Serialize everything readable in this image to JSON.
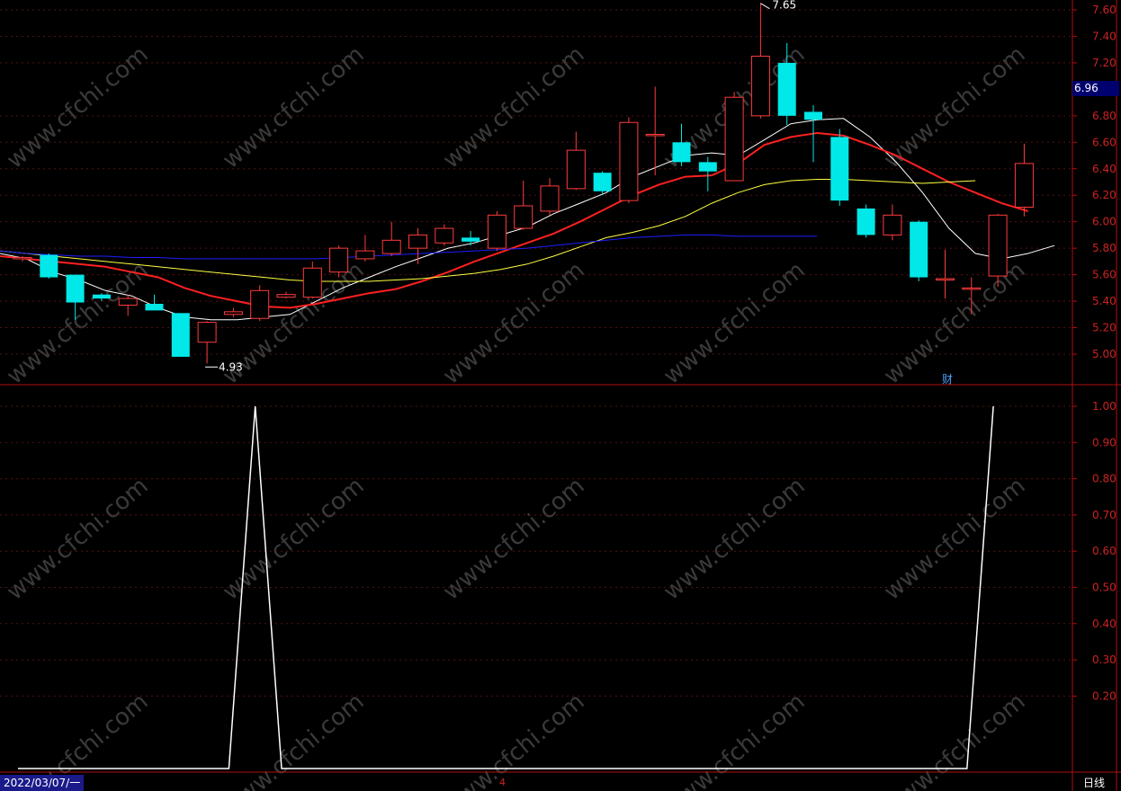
{
  "chart_data": [
    {
      "type": "candlestick",
      "ylim": [
        4.8,
        7.7
      ],
      "y_ticks": [
        "7.60",
        "7.40",
        "7.20",
        "6.80",
        "6.60",
        "6.40",
        "6.20",
        "6.00",
        "5.80",
        "5.60",
        "5.40",
        "5.20",
        "5.00"
      ],
      "candles": [
        {
          "o": 5.72,
          "h": 5.74,
          "l": 5.7,
          "c": 5.73
        },
        {
          "o": 5.75,
          "h": 5.76,
          "l": 5.57,
          "c": 5.58
        },
        {
          "o": 5.6,
          "h": 5.6,
          "l": 5.26,
          "c": 5.39
        },
        {
          "o": 5.45,
          "h": 5.46,
          "l": 5.4,
          "c": 5.42
        },
        {
          "o": 5.37,
          "h": 5.45,
          "l": 5.29,
          "c": 5.42
        },
        {
          "o": 5.38,
          "h": 5.45,
          "l": 5.33,
          "c": 5.33
        },
        {
          "o": 5.31,
          "h": 5.31,
          "l": 4.98,
          "c": 4.98
        },
        {
          "o": 5.09,
          "h": 5.25,
          "l": 4.93,
          "c": 5.24
        },
        {
          "o": 5.3,
          "h": 5.35,
          "l": 5.28,
          "c": 5.32
        },
        {
          "o": 5.27,
          "h": 5.52,
          "l": 5.25,
          "c": 5.48
        },
        {
          "o": 5.43,
          "h": 5.47,
          "l": 5.42,
          "c": 5.45
        },
        {
          "o": 5.43,
          "h": 5.7,
          "l": 5.42,
          "c": 5.65
        },
        {
          "o": 5.62,
          "h": 5.82,
          "l": 5.58,
          "c": 5.8
        },
        {
          "o": 5.72,
          "h": 5.9,
          "l": 5.7,
          "c": 5.78
        },
        {
          "o": 5.76,
          "h": 6.0,
          "l": 5.74,
          "c": 5.86
        },
        {
          "o": 5.8,
          "h": 5.95,
          "l": 5.68,
          "c": 5.9
        },
        {
          "o": 5.84,
          "h": 5.98,
          "l": 5.82,
          "c": 5.95
        },
        {
          "o": 5.88,
          "h": 5.93,
          "l": 5.82,
          "c": 5.85
        },
        {
          "o": 5.8,
          "h": 6.08,
          "l": 5.78,
          "c": 6.05
        },
        {
          "o": 5.95,
          "h": 6.31,
          "l": 5.94,
          "c": 6.12
        },
        {
          "o": 6.08,
          "h": 6.33,
          "l": 6.05,
          "c": 6.27
        },
        {
          "o": 6.25,
          "h": 6.68,
          "l": 6.24,
          "c": 6.54
        },
        {
          "o": 6.37,
          "h": 6.38,
          "l": 6.2,
          "c": 6.23
        },
        {
          "o": 6.16,
          "h": 6.79,
          "l": 6.14,
          "c": 6.75
        },
        {
          "o": 6.65,
          "h": 7.02,
          "l": 6.35,
          "c": 6.66
        },
        {
          "o": 6.6,
          "h": 6.74,
          "l": 6.42,
          "c": 6.45
        },
        {
          "o": 6.45,
          "h": 6.49,
          "l": 6.23,
          "c": 6.38
        },
        {
          "o": 6.31,
          "h": 6.98,
          "l": 6.31,
          "c": 6.94
        },
        {
          "o": 6.8,
          "h": 7.65,
          "l": 6.78,
          "c": 7.25
        },
        {
          "o": 7.2,
          "h": 7.35,
          "l": 6.73,
          "c": 6.8
        },
        {
          "o": 6.83,
          "h": 6.88,
          "l": 6.45,
          "c": 6.77
        },
        {
          "o": 6.64,
          "h": 6.7,
          "l": 6.12,
          "c": 6.16
        },
        {
          "o": 6.1,
          "h": 6.13,
          "l": 5.88,
          "c": 5.9
        },
        {
          "o": 5.9,
          "h": 6.13,
          "l": 5.86,
          "c": 6.05
        },
        {
          "o": 6.0,
          "h": 6.01,
          "l": 5.55,
          "c": 5.58
        },
        {
          "o": 5.57,
          "h": 5.79,
          "l": 5.42,
          "c": 5.57
        },
        {
          "o": 5.5,
          "h": 5.58,
          "l": 5.3,
          "c": 5.5
        },
        {
          "o": 5.59,
          "h": 6.06,
          "l": 5.51,
          "c": 6.05
        },
        {
          "o": 6.11,
          "h": 6.59,
          "l": 6.04,
          "c": 6.44
        }
      ],
      "ma_lines": [
        {
          "color": "#ffffff",
          "values": [
            5.76,
            5.72,
            5.62,
            5.56,
            5.48,
            5.44,
            5.35,
            5.28,
            5.26,
            5.26,
            5.28,
            5.3,
            5.4,
            5.5,
            5.58,
            5.66,
            5.73,
            5.8,
            5.84,
            5.9,
            5.96,
            6.06,
            6.14,
            6.22,
            6.34,
            6.42,
            6.5,
            6.52,
            6.5,
            6.62,
            6.74,
            6.77,
            6.78,
            6.64,
            6.45,
            6.22,
            5.95,
            5.76,
            5.72,
            5.76,
            5.82
          ]
        },
        {
          "color": "#ff2020",
          "values": [
            5.74,
            5.72,
            5.7,
            5.68,
            5.66,
            5.62,
            5.58,
            5.5,
            5.44,
            5.4,
            5.36,
            5.35,
            5.38,
            5.42,
            5.46,
            5.49,
            5.55,
            5.62,
            5.7,
            5.77,
            5.84,
            5.91,
            6.0,
            6.1,
            6.2,
            6.28,
            6.34,
            6.35,
            6.44,
            6.58,
            6.64,
            6.67,
            6.65,
            6.58,
            6.5,
            6.4,
            6.3,
            6.22,
            6.14,
            6.08
          ]
        },
        {
          "color": "#ffff40",
          "values": [
            5.78,
            5.76,
            5.74,
            5.72,
            5.7,
            5.68,
            5.66,
            5.64,
            5.62,
            5.6,
            5.58,
            5.56,
            5.55,
            5.55,
            5.55,
            5.56,
            5.57,
            5.59,
            5.61,
            5.64,
            5.68,
            5.74,
            5.81,
            5.88,
            5.92,
            5.97,
            6.04,
            6.14,
            6.22,
            6.28,
            6.31,
            6.32,
            6.32,
            6.31,
            6.3,
            6.29,
            6.3,
            6.31
          ]
        },
        {
          "color": "#1e1eff",
          "values": [
            5.78,
            5.76,
            5.75,
            5.74,
            5.74,
            5.73,
            5.73,
            5.72,
            5.72,
            5.72,
            5.72,
            5.72,
            5.72,
            5.73,
            5.74,
            5.75,
            5.76,
            5.77,
            5.78,
            5.79,
            5.8,
            5.82,
            5.84,
            5.86,
            5.88,
            5.89,
            5.9,
            5.9,
            5.89,
            5.89,
            5.89,
            5.89
          ]
        }
      ],
      "annotations": [
        {
          "text": "7.65",
          "type": "high"
        },
        {
          "text": "4.93",
          "type": "low"
        }
      ]
    },
    {
      "type": "line",
      "ylim": [
        0,
        1.0
      ],
      "y_ticks": [
        "1.00",
        "0.90",
        "0.80",
        "0.70",
        "0.60",
        "0.50",
        "0.40",
        "0.30",
        "0.20"
      ],
      "values": [
        0,
        0,
        0,
        0,
        0,
        0,
        0,
        0,
        0,
        1,
        0,
        0,
        0,
        0,
        0,
        0,
        0,
        0,
        0,
        0,
        0,
        0,
        0,
        0,
        0,
        0,
        0,
        0,
        0,
        0,
        0,
        0,
        0,
        0,
        0,
        0,
        0,
        1
      ]
    }
  ],
  "price_tag": "6.96",
  "high_label": "7.65",
  "low_label": "4.93",
  "fin_label": "财",
  "date_label": "2022/03/07/一",
  "period_label": "日线",
  "sep_label": "4",
  "watermark": "www.cfchi.com"
}
